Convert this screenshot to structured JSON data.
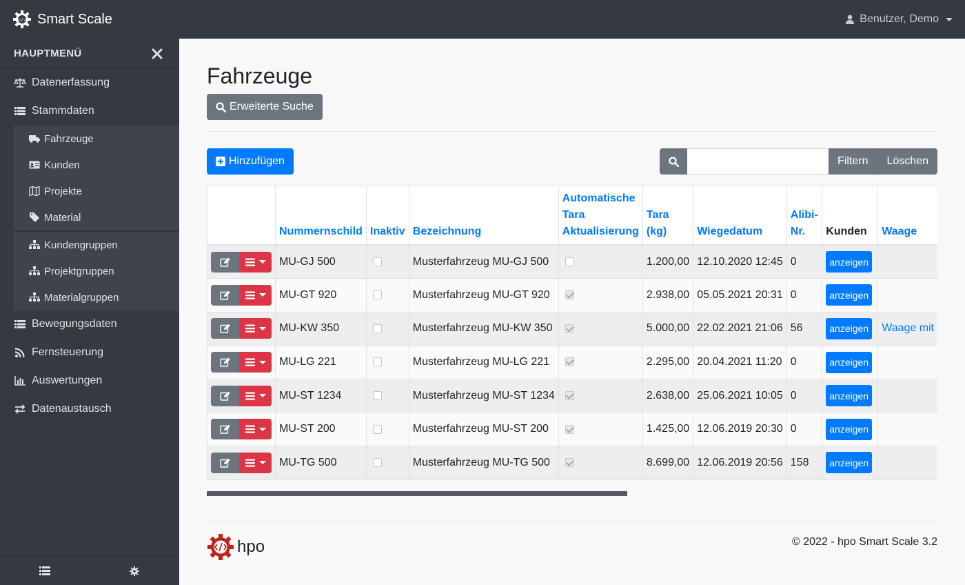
{
  "app": {
    "title": "Smart Scale",
    "user": "Benutzer, Demo"
  },
  "sidebar": {
    "title": "HAUPTMENÜ",
    "items": [
      {
        "label": "Datenerfassung",
        "icon": "balance-scale-icon"
      },
      {
        "label": "Stammdaten",
        "icon": "list-icon"
      },
      {
        "label": "Bewegungsdaten",
        "icon": "list-icon"
      },
      {
        "label": "Fernsteuerung",
        "icon": "rss-icon"
      },
      {
        "label": "Auswertungen",
        "icon": "bar-chart-icon"
      },
      {
        "label": "Datenaustausch",
        "icon": "exchange-icon"
      }
    ],
    "sub_items": [
      {
        "label": "Fahrzeuge",
        "icon": "truck-icon"
      },
      {
        "label": "Kunden",
        "icon": "id-card-icon"
      },
      {
        "label": "Projekte",
        "icon": "map-icon"
      },
      {
        "label": "Material",
        "icon": "tag-icon"
      },
      {
        "label": "Kundengruppen",
        "icon": "sitemap-icon"
      },
      {
        "label": "Projektgruppen",
        "icon": "sitemap-icon"
      },
      {
        "label": "Materialgruppen",
        "icon": "sitemap-icon"
      }
    ]
  },
  "page": {
    "title": "Fahrzeuge",
    "advanced_search_label": "Erweiterte Suche",
    "add_label": "Hinzufügen",
    "filter_label": "Filtern",
    "clear_label": "Löschen",
    "search_value": ""
  },
  "table": {
    "headers": {
      "plate": "Nummernschild",
      "inactive": "Inaktiv",
      "name": "Bezeichnung",
      "auto_tara_1": "Automatische",
      "auto_tara_2": "Tara",
      "auto_tara_3": "Aktualisierung",
      "tara_1": "Tara",
      "tara_2": "(kg)",
      "date": "Wiegedatum",
      "alibi_1": "Alibi-",
      "alibi_2": "Nr.",
      "customers": "Kunden",
      "scale": "Waage"
    },
    "show_label": "anzeigen",
    "rows": [
      {
        "plate": "MU-GJ 500",
        "inactive": false,
        "name": "Musterfahrzeug MU-GJ 500",
        "auto_tara": false,
        "tara": "1.200,00",
        "date": "12.10.2020 12:45",
        "alibi": "0",
        "scale": ""
      },
      {
        "plate": "MU-GT 920",
        "inactive": false,
        "name": "Musterfahrzeug MU-GT 920",
        "auto_tara": true,
        "tara": "2.938,00",
        "date": "05.05.2021 20:31",
        "alibi": "0",
        "scale": ""
      },
      {
        "plate": "MU-KW 350",
        "inactive": false,
        "name": "Musterfahrzeug MU-KW 350",
        "auto_tara": true,
        "tara": "5.000,00",
        "date": "22.02.2021 21:06",
        "alibi": "56",
        "scale": "Waage mit Ka"
      },
      {
        "plate": "MU-LG 221",
        "inactive": false,
        "name": "Musterfahrzeug MU-LG 221",
        "auto_tara": true,
        "tara": "2.295,00",
        "date": "20.04.2021 11:20",
        "alibi": "0",
        "scale": ""
      },
      {
        "plate": "MU-ST 1234",
        "inactive": false,
        "name": "Musterfahrzeug MU-ST 1234",
        "auto_tara": true,
        "tara": "2.638,00",
        "date": "25.06.2021 10:05",
        "alibi": "0",
        "scale": ""
      },
      {
        "plate": "MU-ST 200",
        "inactive": false,
        "name": "Musterfahrzeug MU-ST 200",
        "auto_tara": true,
        "tara": "1.425,00",
        "date": "12.06.2019 20:30",
        "alibi": "0",
        "scale": ""
      },
      {
        "plate": "MU-TG 500",
        "inactive": false,
        "name": "Musterfahrzeug MU-TG 500",
        "auto_tara": true,
        "tara": "8.699,00",
        "date": "12.06.2019 20:56",
        "alibi": "158",
        "scale": ""
      }
    ]
  },
  "footer": {
    "logo_text": "hpo",
    "copyright": "© 2022 - hpo Smart Scale 3.2"
  },
  "colors": {
    "primary": "#007bff",
    "danger": "#dc3545",
    "secondary": "#6c757d",
    "dark": "#343a40",
    "logo_red": "#c0241c"
  }
}
